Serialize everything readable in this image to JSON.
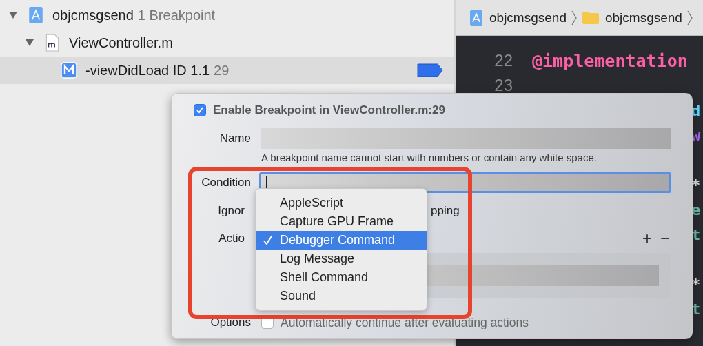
{
  "navigator": {
    "groups": [
      {
        "name": "objcmsgsend",
        "count": "1 Breakpoint",
        "expanded": true,
        "children": [
          {
            "name": "ViewController.m",
            "expanded": true,
            "children": [
              {
                "name": "-viewDidLoad  ID 1.1",
                "line": "29",
                "selected": true,
                "enabled": true
              }
            ]
          }
        ]
      }
    ]
  },
  "breadcrumb": [
    {
      "label": "objcmsgsend",
      "kind": "project"
    },
    {
      "label": "objcmsgsend",
      "kind": "folder"
    }
  ],
  "editor": {
    "lines": [
      {
        "number": "22",
        "code": "@implementation",
        "kind": "keyword"
      },
      {
        "number": "23",
        "kind": "blank"
      },
      {
        "code": "d",
        "kind": "type"
      },
      {
        "code": "w",
        "kind": "property"
      },
      {
        "kind": "blank"
      },
      {
        "code": "*",
        "kind": "plain"
      },
      {
        "code": "e",
        "kind": "method"
      },
      {
        "code": "t",
        "kind": "method"
      },
      {
        "kind": "blank"
      },
      {
        "code": "*",
        "kind": "plain"
      },
      {
        "code": "t",
        "kind": "method"
      }
    ]
  },
  "popover": {
    "enable": {
      "label": "Enable Breakpoint in ViewController.m:29",
      "checked": true
    },
    "name": {
      "label": "Name",
      "hint": "A breakpoint name cannot start with numbers or contain any white space."
    },
    "condition": {
      "label": "Condition",
      "focused": true
    },
    "ignore": {
      "label": "Ignor",
      "suffix": "pping"
    },
    "action": {
      "label": "Actio",
      "add": "+",
      "remove": "−"
    },
    "options": {
      "label": "Options",
      "auto_continue": {
        "label": "Automatically continue after evaluating actions",
        "checked": false
      }
    }
  },
  "action_menu": {
    "items": [
      {
        "label": "AppleScript",
        "selected": false
      },
      {
        "label": "Capture GPU Frame",
        "selected": false
      },
      {
        "label": "Debugger Command",
        "selected": true
      },
      {
        "label": "Log Message",
        "selected": false
      },
      {
        "label": "Shell Command",
        "selected": false
      },
      {
        "label": "Sound",
        "selected": false
      }
    ]
  }
}
